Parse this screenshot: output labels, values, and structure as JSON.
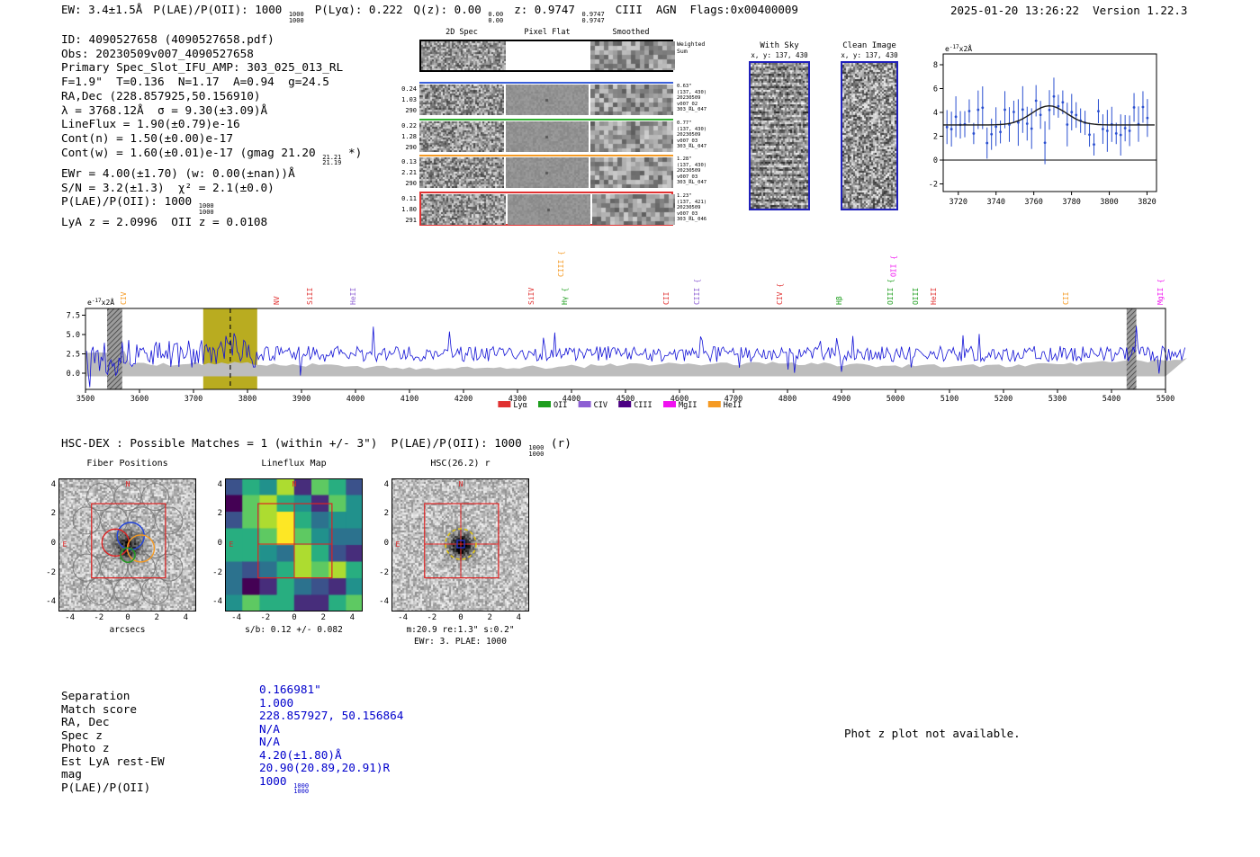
{
  "header": {
    "segments": [
      {
        "text": "EW: 3.4±1.5Å"
      },
      {
        "text": "P(LAE)/P(OII): 1000 ",
        "frac_top": "1000",
        "frac_bot": "1000"
      },
      {
        "text": "P(Lyα): 0.222"
      },
      {
        "text": "Q(z): 0.00 ",
        "frac_top": "0.00",
        "frac_bot": "0.00"
      },
      {
        "text": "z: 0.9747 ",
        "frac_top": "0.9747",
        "frac_bot": "0.9747"
      },
      {
        "text": "CIII  AGN  Flags:0x00400009"
      }
    ],
    "timestamp": "2025-01-20 13:26:22",
    "version": "Version 1.22.3"
  },
  "info": {
    "lines": [
      {
        "text": "ID: 4090527658 (4090527658.pdf)"
      },
      {
        "text": "Obs: 20230509v007_4090527658"
      },
      {
        "text": "Primary Spec_Slot_IFU_AMP: 303_025_013_RL"
      },
      {
        "text": "F=1.9\"  T=0.136  N=1.17  A=0.94  g=24.5"
      },
      {
        "text": "RA,Dec (228.857925,50.156910)"
      },
      {
        "text": "λ = 3768.12Å  σ = 9.30(±3.09)Å"
      },
      {
        "text": "LineFlux = 1.90(±0.79)e-16"
      },
      {
        "text": "Cont(n) = 1.50(±0.00)e-17"
      },
      {
        "text": "Cont(w) = 1.60(±0.01)e-17 (gmag 21.20 ",
        "frac_top": "21.21",
        "frac_bot": "21.19",
        "post": " *)"
      },
      {
        "text": "EWr = 4.00(±1.70) (w: 0.00(±nan))Å"
      },
      {
        "text": "S/N = 3.2(±1.3)  χ² = 2.1(±0.0)"
      },
      {
        "text": "P(LAE)/P(OII): 1000 ",
        "frac_top": "1000",
        "frac_bot": "1000"
      },
      {
        "text": "LyA z = 2.0996  OII z = 0.0108"
      }
    ]
  },
  "cutouts": {
    "col_headers": [
      "2D Spec",
      "Pixel Flat",
      "Smoothed"
    ],
    "weighted_label_lines": [
      "Weighted",
      "Sum"
    ],
    "rows": [
      {
        "left": [
          "0.24",
          "1.03",
          "290"
        ],
        "right": [
          "0.63\"",
          "(137, 430)",
          "20230509",
          "v007_02",
          "303_RL_047"
        ],
        "color": "#3a5fd9"
      },
      {
        "left": [
          "0.22",
          "1.28",
          "290"
        ],
        "right": [
          "0.77\"",
          "(137, 430)",
          "20230509",
          "v007_03",
          "303_RL_047"
        ],
        "color": "#2fae2f"
      },
      {
        "left": [
          "0.13",
          "2.21",
          "290"
        ],
        "right": [
          "1.28\"",
          "(137, 430)",
          "20230509",
          "v007_03",
          "303_RL_047"
        ],
        "color": "#f59a23"
      },
      {
        "left": [
          "0.11",
          "1.80",
          "291"
        ],
        "right": [
          "1.23\"",
          "(137, 421)",
          "20230509",
          "v007_03",
          "303_RL_046"
        ],
        "color": "#e03131"
      }
    ]
  },
  "sky_panels": [
    {
      "title": "With Sky",
      "subtitle": "x, y: 137, 430"
    },
    {
      "title": "Clean Image",
      "subtitle": "x, y: 137, 430"
    }
  ],
  "hsc_line": {
    "text": "HSC-DEX : Possible Matches = 1 (within +/- 3\")  P(LAE)/P(OII): 1000 ",
    "frac_top": "1000",
    "frac_bot": "1000",
    "post": " (r)"
  },
  "panels": [
    {
      "title": "Fiber Positions",
      "caption": "arcsecs",
      "axis_ticks": [
        -4,
        -2,
        0,
        2,
        4
      ],
      "compass_n": "N",
      "compass_e": "E"
    },
    {
      "title": "Lineflux Map",
      "caption": "s/b: 0.12 +/- 0.082",
      "axis_ticks": [
        -4,
        -2,
        0,
        2,
        4
      ],
      "compass_n": "N",
      "compass_e": "E"
    },
    {
      "title": "HSC(26.2) r",
      "caption": "m:20.9 re:1.3\" s:0.2\"",
      "caption2": "EWr: 3. PLAE: 1000",
      "axis_ticks": [
        -4,
        -2,
        0,
        2,
        4
      ],
      "compass_n": "N",
      "compass_e": "E"
    }
  ],
  "summary": {
    "value_color": "#0000cc",
    "rows": [
      {
        "label": "Separation",
        "value": "0.166981\""
      },
      {
        "label": "Match score",
        "value": "1.000"
      },
      {
        "label": "RA, Dec",
        "value": "228.857927, 50.156864"
      },
      {
        "label": "Spec z",
        "value": "N/A"
      },
      {
        "label": "Photo z",
        "value": "N/A"
      },
      {
        "label": "Est LyA rest-EW",
        "value": "4.20(±1.80)Å"
      },
      {
        "label": "mag",
        "value": "20.90(20.89,20.91)R"
      },
      {
        "label": "P(LAE)/P(OII)",
        "value": "1000 ",
        "frac_top": "1000",
        "frac_bot": "1000"
      }
    ]
  },
  "notes": {
    "photz": "Phot z plot not available."
  },
  "chart_data": [
    {
      "id": "line_fit",
      "type": "scatter",
      "title": "emission line gaussian fit around 3768Å",
      "unit_label": "e-17x2Å",
      "x_ticks": [
        3720,
        3740,
        3760,
        3780,
        3800,
        3820
      ],
      "y_ticks": [
        -2,
        0,
        2,
        4,
        6,
        8
      ],
      "x_range": [
        3712,
        3825
      ],
      "y_range": [
        -2.6,
        8.9
      ],
      "marker_color": "#2a4fd0",
      "fit_color": "#1a1a1a",
      "fit": {
        "center": 3768.12,
        "sigma": 9.3,
        "amplitude": 1.6,
        "baseline": 2.95
      },
      "n_points": 46,
      "seed": 7
    },
    {
      "id": "full_spectrum",
      "type": "line",
      "title": "full 1D spectrum",
      "unit_label": "e-17x2Å",
      "x_range": [
        3500,
        5540
      ],
      "y_range": [
        -2.1,
        8.4
      ],
      "x_ticks": [
        3500,
        3600,
        3700,
        3800,
        3900,
        4000,
        4100,
        4200,
        4300,
        4400,
        4500,
        4600,
        4700,
        4800,
        4900,
        5000,
        5100,
        5200,
        5300,
        5400,
        5500
      ],
      "y_ticks": [
        0,
        2.5,
        5,
        7.5
      ],
      "line_color": "#1212d6",
      "error_band_color": "#bdbdbd",
      "highlight_band": {
        "start": 3718,
        "end": 3818,
        "color": "#b9ac20"
      },
      "target_line": {
        "wavelength": 3768.12,
        "color": "#111111",
        "style": "dashed"
      },
      "masked_regions": [
        {
          "start": 3540,
          "end": 3568
        },
        {
          "start": 5428,
          "end": 5446
        }
      ],
      "markers": [
        {
          "label": "CIV",
          "wavelength": 3575,
          "color": "#f59a23"
        },
        {
          "label": "NV",
          "wavelength": 3858,
          "color": "#e03131"
        },
        {
          "label": "SiII",
          "wavelength": 3920,
          "color": "#e03131"
        },
        {
          "label": "HeII",
          "wavelength": 4000,
          "color": "#8d5fd3"
        },
        {
          "label": "SiIV",
          "wavelength": 4330,
          "color": "#e03131"
        },
        {
          "label": "CIII {",
          "wavelength": 4385,
          "color": "#f59a23",
          "tall": true
        },
        {
          "label": "Hγ {",
          "wavelength": 4392,
          "color": "#1e9e1e"
        },
        {
          "label": "CII",
          "wavelength": 4580,
          "color": "#e03131"
        },
        {
          "label": "CIII {",
          "wavelength": 4637,
          "color": "#8d5fd3"
        },
        {
          "label": "CIV {",
          "wavelength": 4790,
          "color": "#e03131"
        },
        {
          "label": "Hβ",
          "wavelength": 4900,
          "color": "#1e9e1e"
        },
        {
          "label": "OIII {",
          "wavelength": 4995,
          "color": "#1e9e1e"
        },
        {
          "label": "OII {",
          "wavelength": 5001,
          "color": "#f012f0",
          "tall": true
        },
        {
          "label": "OIII",
          "wavelength": 5042,
          "color": "#1e9e1e"
        },
        {
          "label": "HeII",
          "wavelength": 5075,
          "color": "#e03131"
        },
        {
          "label": "CII",
          "wavelength": 5320,
          "color": "#f59a23"
        },
        {
          "label": "MgII {",
          "wavelength": 5495,
          "color": "#f012f0"
        }
      ],
      "legend": [
        {
          "label": "Lyα",
          "color": "#e03131"
        },
        {
          "label": "OII",
          "color": "#1e9e1e"
        },
        {
          "label": "CIV",
          "color": "#8d5fd3"
        },
        {
          "label": "CIII",
          "color": "#4b0082"
        },
        {
          "label": "MgII",
          "color": "#f012f0"
        },
        {
          "label": "HeII",
          "color": "#f59a23"
        }
      ],
      "seed": 13
    }
  ]
}
